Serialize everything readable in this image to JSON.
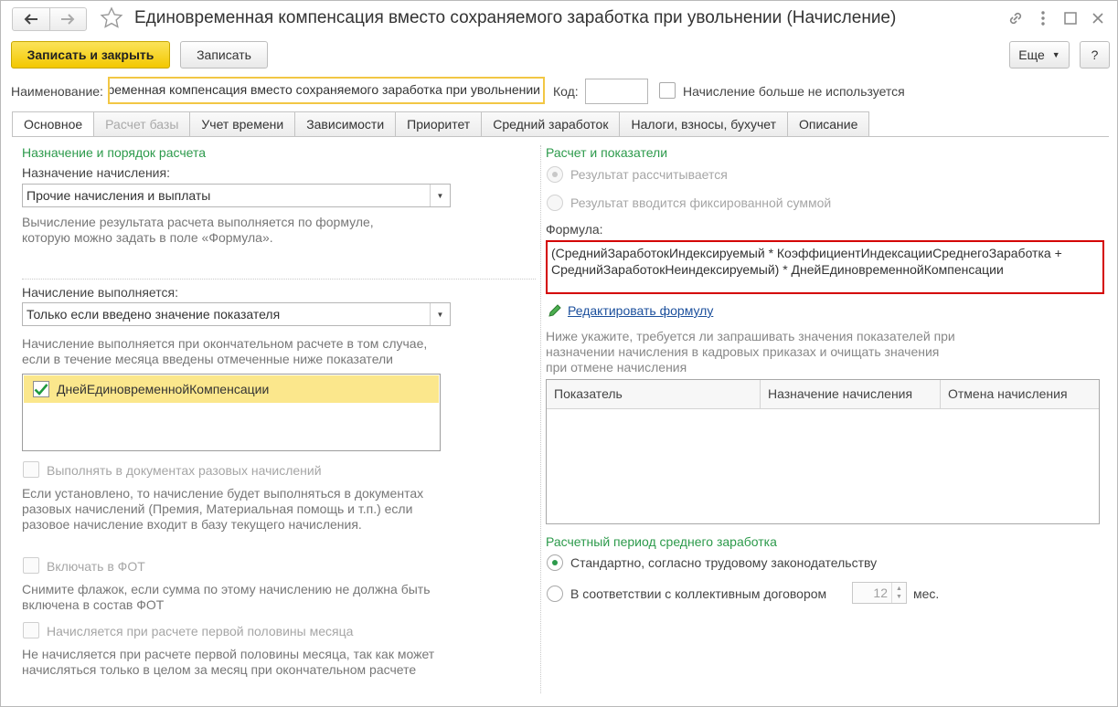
{
  "window": {
    "title": "Единовременная компенсация вместо сохраняемого заработка при увольнении (Начисление)"
  },
  "toolbar": {
    "save_close": "Записать и закрыть",
    "save": "Записать",
    "more": "Еще",
    "help": "?"
  },
  "header": {
    "name_label": "Наименование:",
    "name_value": "Единовременная компенсация вместо сохраняемого заработка при увольнении",
    "code_label": "Код:",
    "code_value": "",
    "not_used_label": "Начисление больше не используется"
  },
  "tabs": [
    {
      "label": "Основное"
    },
    {
      "label": "Расчет базы"
    },
    {
      "label": "Учет времени"
    },
    {
      "label": "Зависимости"
    },
    {
      "label": "Приоритет"
    },
    {
      "label": "Средний заработок"
    },
    {
      "label": "Налоги, взносы, бухучет"
    },
    {
      "label": "Описание"
    }
  ],
  "left": {
    "section_title": "Назначение и порядок расчета",
    "purpose_label": "Назначение начисления:",
    "purpose_value": "Прочие начисления и выплаты",
    "purpose_hint": "Вычисление результата расчета выполняется по формуле, которую можно задать в поле «Формула».",
    "exec_label": "Начисление выполняется:",
    "exec_value": "Только если введено значение показателя",
    "exec_hint": "Начисление выполняется при окончательном расчете в том случае, если в течение месяца введены отмеченные ниже показатели",
    "indicator_item": "ДнейЕдиновременнойКомпенсации",
    "one_time_label": "Выполнять в документах разовых начислений",
    "one_time_hint": "Если установлено, то начисление будет выполняться в документах разовых начислений (Премия, Материальная помощь и т.п.) если разовое начисление входит в базу текущего начисления.",
    "fot_label": "Включать в ФОТ",
    "fot_hint": "Снимите флажок, если сумма по этому начислению не должна быть включена в состав ФОТ",
    "first_half_label": "Начисляется при расчете первой половины месяца",
    "first_half_hint": "Не начисляется при расчете первой половины месяца, так как может начисляться только в целом за месяц при окончательном расчете"
  },
  "right": {
    "section_title": "Расчет и показатели",
    "radio_calc": "Результат рассчитывается",
    "radio_fixed": "Результат вводится фиксированной суммой",
    "formula_label": "Формула:",
    "formula_value": "(СреднийЗаработокИндексируемый * КоэффициентИндексацииСреднегоЗаработка + СреднийЗаработокНеиндексируемый) * ДнейЕдиновременнойКомпенсации",
    "edit_formula": "Редактировать формулу",
    "table_hint": "Ниже укажите, требуется ли запрашивать значения показателей при назначении начисления в кадровых приказах и очищать значения при отмене начисления",
    "table_headers": [
      "Показатель",
      "Назначение начисления",
      "Отмена начисления"
    ],
    "period_title": "Расчетный период среднего заработка",
    "period_standard": "Стандартно, согласно трудовому законодательству",
    "period_collective": "В соответствии с коллективным договором",
    "months_value": "12",
    "months_unit": "мес."
  },
  "colors": {
    "accent_yellow": "#f3c800",
    "section_green": "#2c9a4b",
    "formula_border": "#d40000",
    "link_blue": "#1b4f9c"
  }
}
